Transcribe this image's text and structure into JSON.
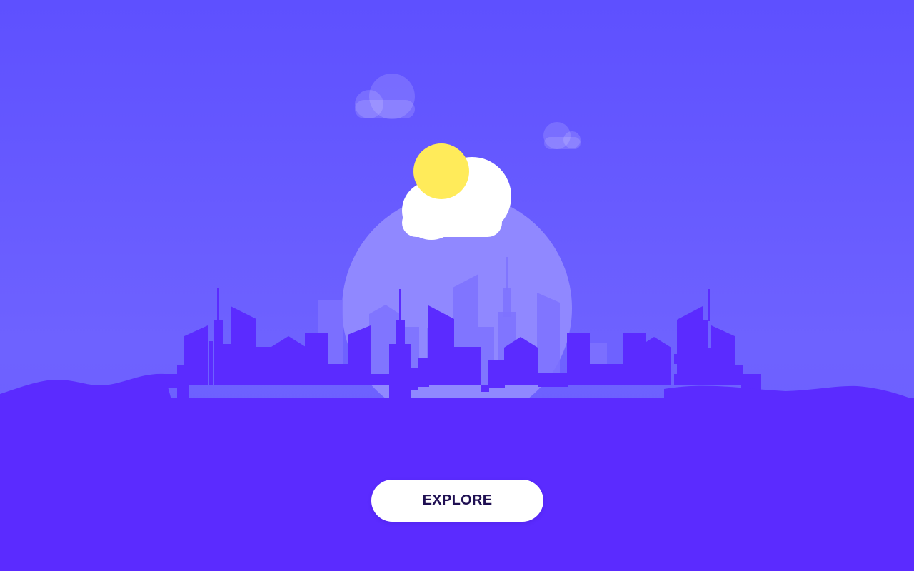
{
  "hero": {
    "explore_label": "EXPLORE"
  },
  "colors": {
    "background_top": "#5e50ff",
    "background_bottom": "#6b5cff",
    "ground": "#5b2bff",
    "sun": "#ffeb5a",
    "cloud": "#ffffff",
    "moon_circle": "#9088ff",
    "button_text": "#1f0f52"
  },
  "icons": [
    "sun-icon",
    "cloud-icon",
    "city-skyline",
    "small-cloud-icon"
  ]
}
